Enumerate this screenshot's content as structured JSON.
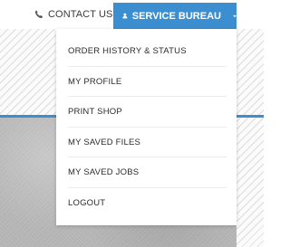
{
  "header": {
    "contact_label": "CONTACT US",
    "account_label": "SERVICE BUREAU",
    "accent_color": "#3b8fd0"
  },
  "menu": {
    "items": [
      {
        "label": "ORDER HISTORY & STATUS"
      },
      {
        "label": "MY PROFILE"
      },
      {
        "label": "PRINT SHOP"
      },
      {
        "label": "MY SAVED FILES"
      },
      {
        "label": "MY SAVED JOBS"
      },
      {
        "label": "LOGOUT"
      }
    ]
  },
  "icons": {
    "contact": "phone-icon",
    "account": "user-icon",
    "dropdown": "caret-down-icon"
  }
}
